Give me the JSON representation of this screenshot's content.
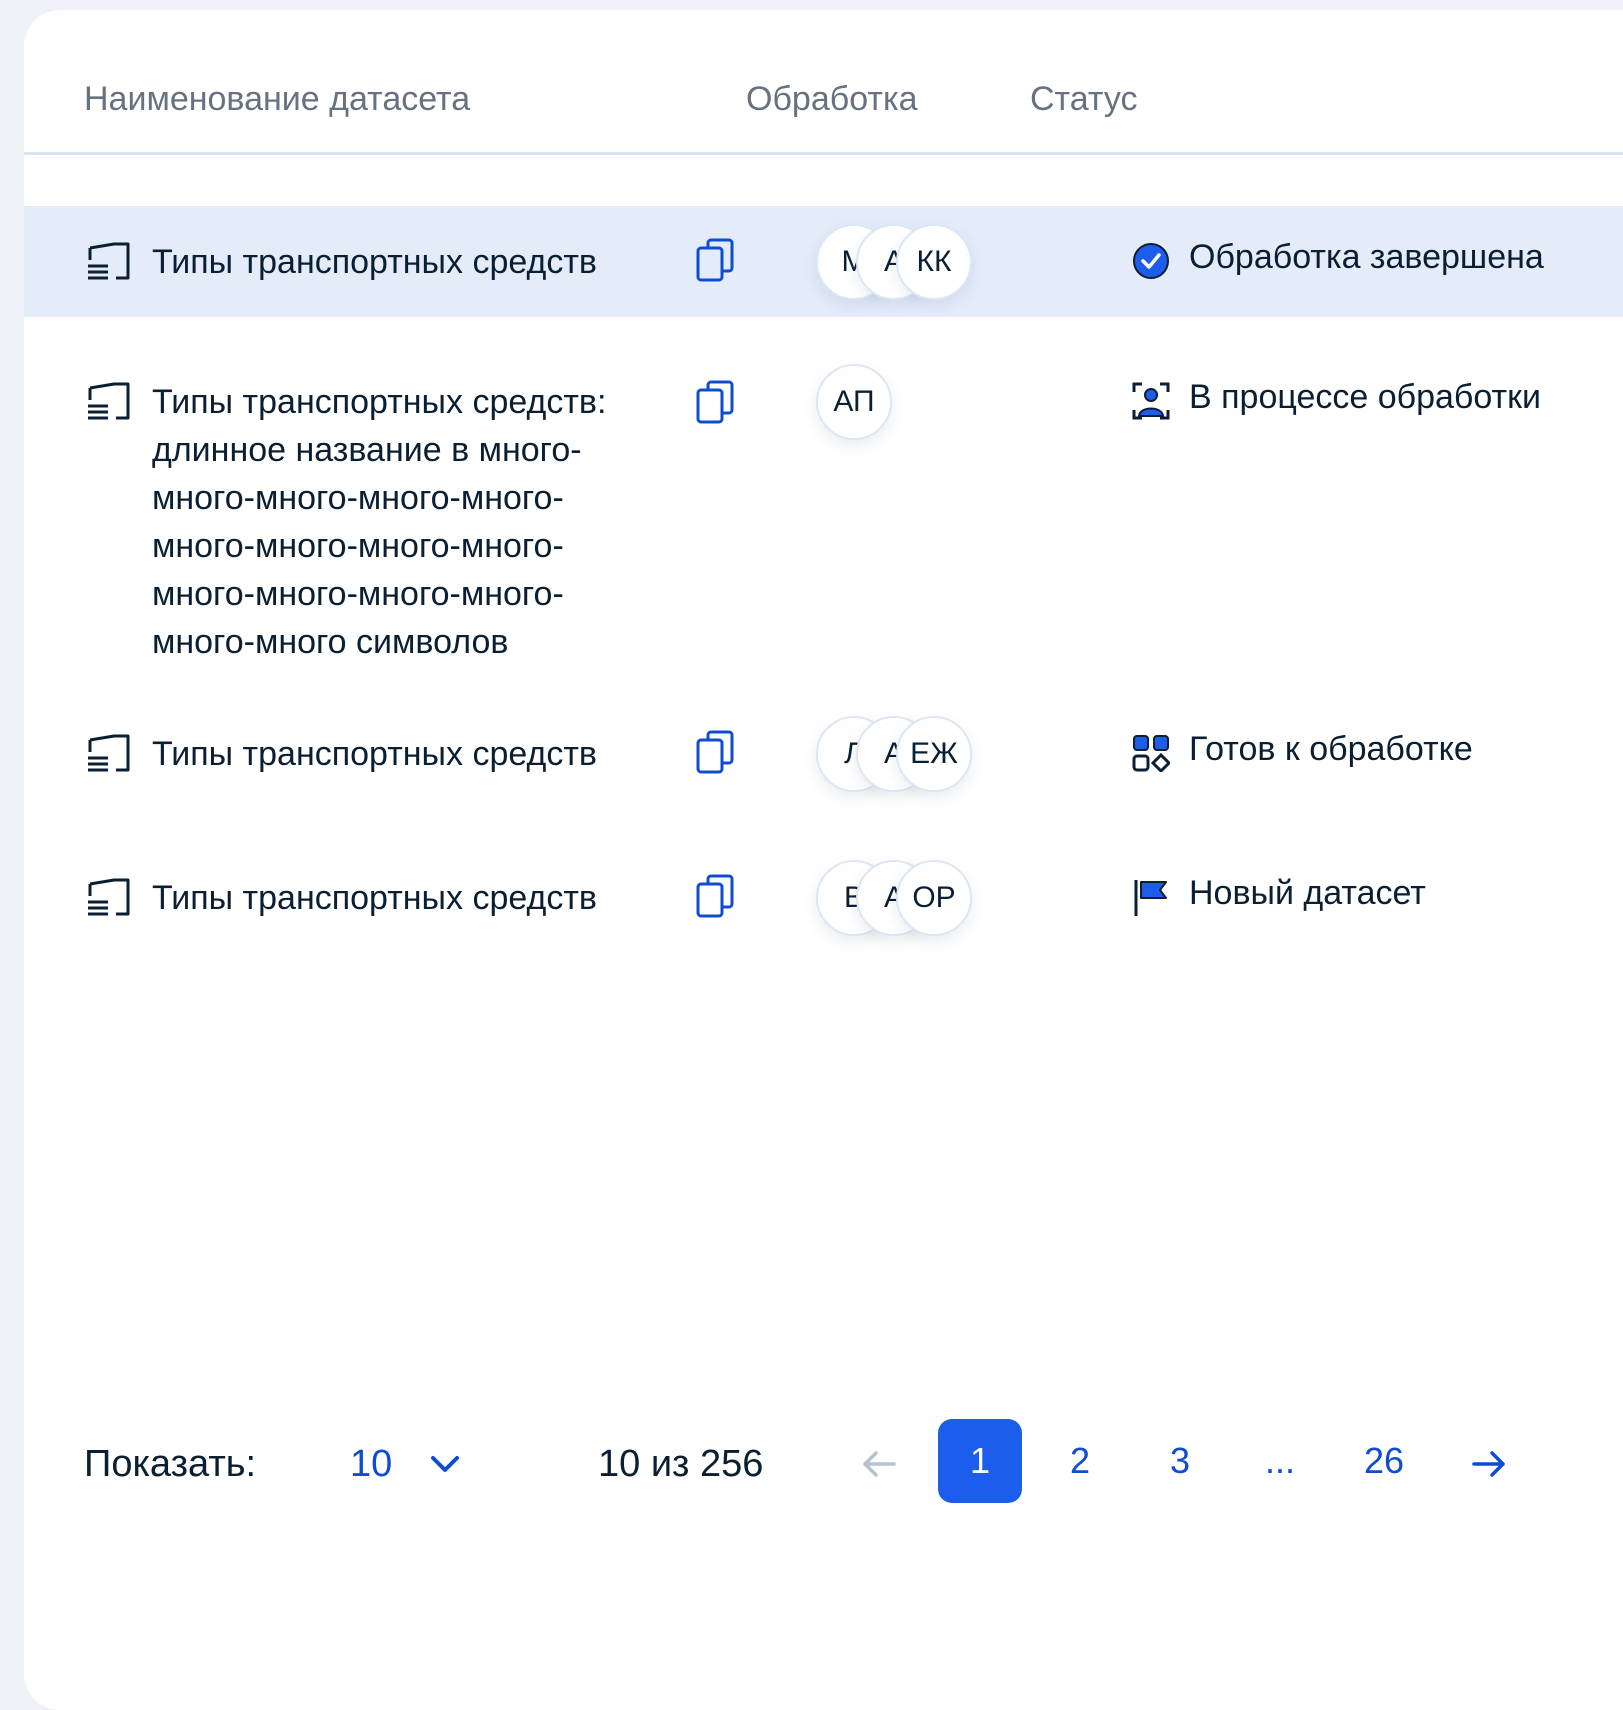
{
  "table": {
    "columns": {
      "name": "Наименование датасета",
      "processing": "Обработка",
      "status": "Статус"
    },
    "rows": [
      {
        "name": "Типы транспортных средств",
        "avatars": [
          "М",
          "А",
          "КК"
        ],
        "status": "Обработка завершена",
        "status_icon": "check-circle-icon",
        "selected": true
      },
      {
        "name": "Типы транспортных средств: длинное название в много-много-много-много-много-много-много-много-много-много-много-много-много-много-много символов",
        "avatars": [
          "АП"
        ],
        "status": "В процессе обработки",
        "status_icon": "user-scan-icon",
        "selected": false
      },
      {
        "name": "Типы транспортных средств",
        "avatars": [
          "Л",
          "А",
          "ЕЖ"
        ],
        "status": "Готов к обработке",
        "status_icon": "grid-shapes-icon",
        "selected": false
      },
      {
        "name": "Типы транспортных средств",
        "avatars": [
          "В",
          "А",
          "ОР"
        ],
        "status": "Новый датасет",
        "status_icon": "flag-icon",
        "selected": false
      }
    ]
  },
  "pagination": {
    "show_label": "Показать:",
    "page_size": "10",
    "count_text": "10 из 256",
    "pages": [
      "1",
      "2",
      "3",
      "...",
      "26"
    ],
    "current_page": "1"
  },
  "colors": {
    "accent": "#1d5deb",
    "link": "#0d4cd3",
    "row_selected": "#e4ecfa",
    "text": "#0b1f33",
    "muted": "#66727f"
  }
}
